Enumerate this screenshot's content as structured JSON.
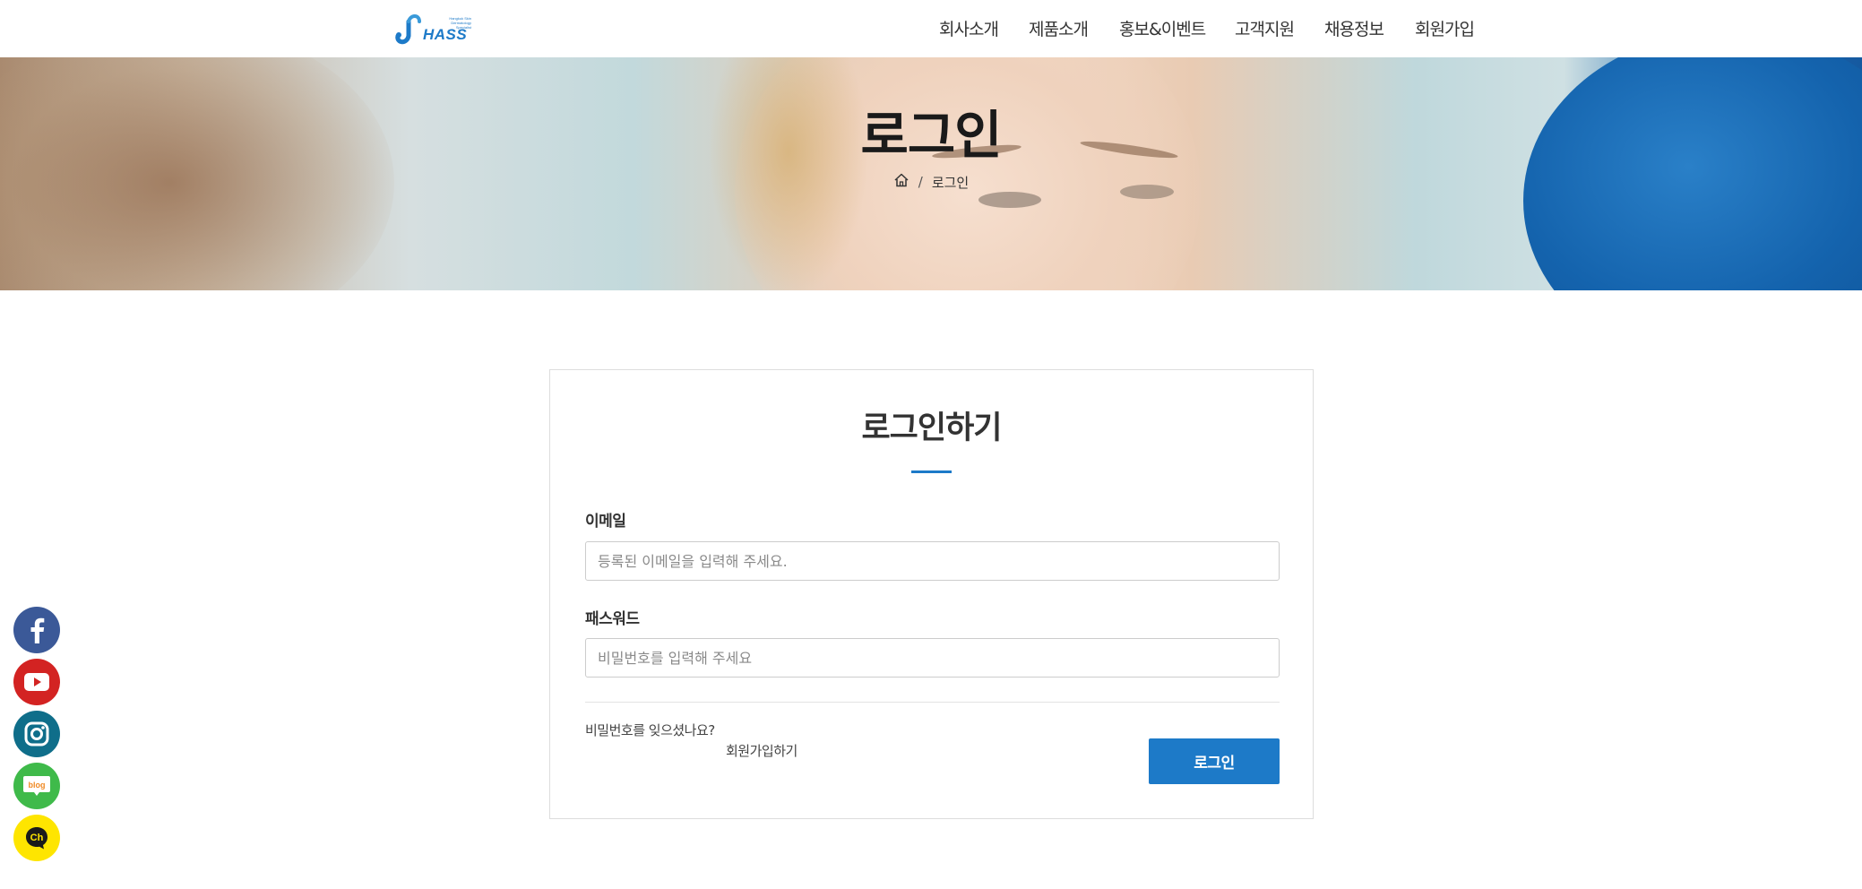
{
  "header": {
    "logo": {
      "text": "HASS",
      "sub": "Hangkuk Skin Dermatology Specialist"
    },
    "nav": [
      {
        "label": "회사소개"
      },
      {
        "label": "제품소개"
      },
      {
        "label": "홍보&이벤트"
      },
      {
        "label": "고객지원"
      },
      {
        "label": "채용정보"
      },
      {
        "label": "회원가입"
      }
    ]
  },
  "hero": {
    "title": "로그인",
    "breadcrumb": {
      "home_icon": "home-icon",
      "separator": "/",
      "current": "로그인"
    }
  },
  "login": {
    "title": "로그인하기",
    "email": {
      "label": "이메일",
      "value": "",
      "placeholder": "등록된 이메일을 입력해 주세요."
    },
    "password": {
      "label": "패스워드",
      "value": "",
      "placeholder": "비밀번호를 입력해 주세요"
    },
    "forgot_link": "비밀번호를 잊으셨나요?",
    "signup_link": "회원가입하기",
    "submit_label": "로그인"
  },
  "social": [
    {
      "icon": "facebook-icon",
      "color": "#3b5998"
    },
    {
      "icon": "youtube-icon",
      "color": "#d32322"
    },
    {
      "icon": "instagram-icon",
      "color": "#0f6e8a"
    },
    {
      "icon": "blog-icon",
      "label": "blog",
      "color": "#3fba4a"
    },
    {
      "icon": "kakao-channel-icon",
      "label": "Ch",
      "color": "#fee500"
    }
  ],
  "colors": {
    "accent": "#1d7ac8",
    "text": "#333333",
    "border": "#dddddd"
  }
}
